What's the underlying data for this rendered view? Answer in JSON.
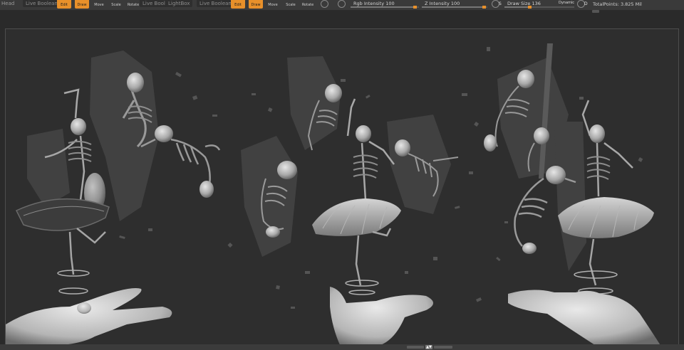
{
  "toolbar": {
    "left_label": "Head",
    "live_boolean_1": "Live Boolean",
    "edit_label": "Edit",
    "draw_label": "Draw",
    "move_label": "Move",
    "scale_label": "Scale",
    "rotate_label": "Rotate",
    "live_boolean_2": "Live Boolean",
    "light_label": "LightBox",
    "live_boolean_3": "Live Boolean",
    "rgb_intensity_label": "Rgb Intensity 100",
    "rgb_intensity_value": 100,
    "z_intensity_label": "Z Intensity 100",
    "z_intensity_value": 100,
    "draw_size_label": "Draw Size 136",
    "draw_size_value": 136,
    "dynamic_label": "Dynamic",
    "focal_shift_value": "0",
    "s_label": "S",
    "d_label": "D",
    "total_points": "TotalPoints: 3.825 Mil",
    "accent_color": "#e8902a"
  },
  "bottom_nav": {
    "arrow_label": "▲▼"
  }
}
